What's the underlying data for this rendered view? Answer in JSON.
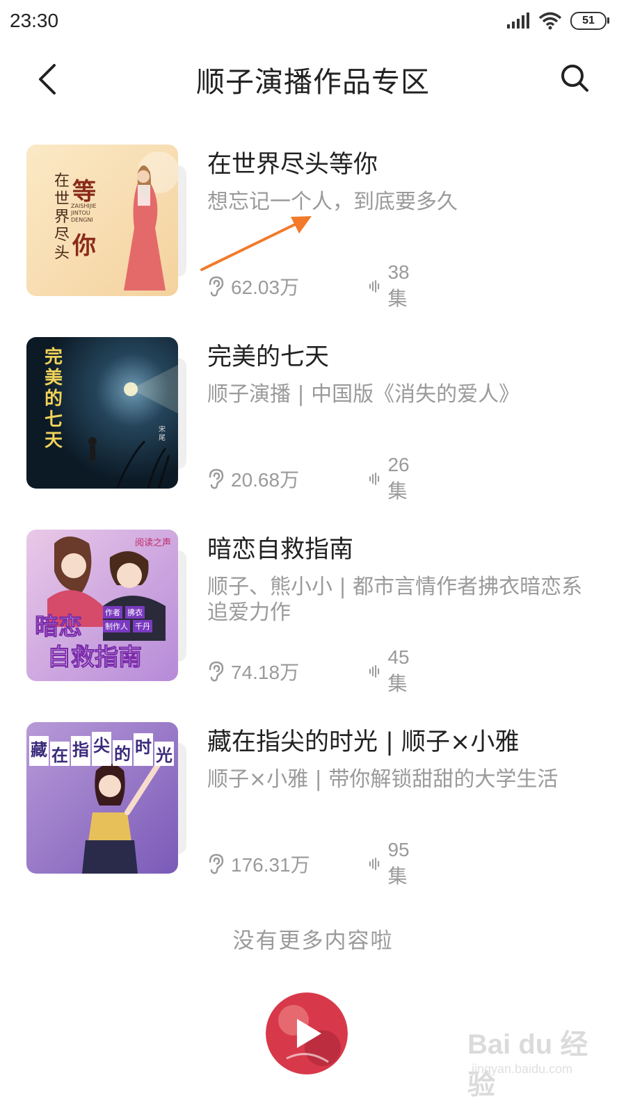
{
  "status_bar": {
    "time": "23:30",
    "battery": "51"
  },
  "header": {
    "title": "顺子演播作品专区"
  },
  "items": [
    {
      "title": "在世界尽头等你",
      "desc": "想忘记一个人，到底要多久",
      "plays": "62.03万",
      "episodes": "38集",
      "cover_text": [
        "在",
        "世",
        "界",
        "尽",
        "头"
      ],
      "cover_text2": [
        "等",
        "你"
      ],
      "cover_pinyin": "ZAISHIJIE JINTOU DENGNI"
    },
    {
      "title": "完美的七天",
      "desc": "顺子演播 | 中国版《消失的爱人》",
      "plays": "20.68万",
      "episodes": "26集",
      "cover_text": [
        "完",
        "美",
        "的",
        "七",
        "天"
      ],
      "cover_author": "宋尾"
    },
    {
      "title": "暗恋自救指南",
      "desc": "顺子、熊小小 | 都市言情作者拂衣暗恋系追爱力作",
      "plays": "74.18万",
      "episodes": "45集",
      "cover_text": [
        "暗恋",
        "自救指南"
      ],
      "cover_top": "阅读之声",
      "cover_tags": [
        "作者",
        "拂衣",
        "制作人",
        "千丹"
      ]
    },
    {
      "title": "藏在指尖的时光 | 顺子×小雅",
      "desc": "顺子×小雅 | 带你解锁甜甜的大学生活",
      "plays": "176.31万",
      "episodes": "95集",
      "cover_text": [
        "藏",
        "在",
        "指",
        "尖",
        "的",
        "时",
        "光"
      ]
    }
  ],
  "footer": {
    "no_more": "没有更多内容啦"
  },
  "watermark": {
    "brand": "Bai du 经验",
    "url": "jingyan.baidu.com"
  },
  "colors": {
    "accent": "#f27a2a",
    "muted": "#9a9a9a",
    "text": "#222222"
  },
  "icons": [
    "back-icon",
    "search-icon",
    "signal-icon",
    "wifi-icon",
    "battery-icon",
    "ear-icon",
    "sound-wave-icon",
    "play-icon"
  ]
}
